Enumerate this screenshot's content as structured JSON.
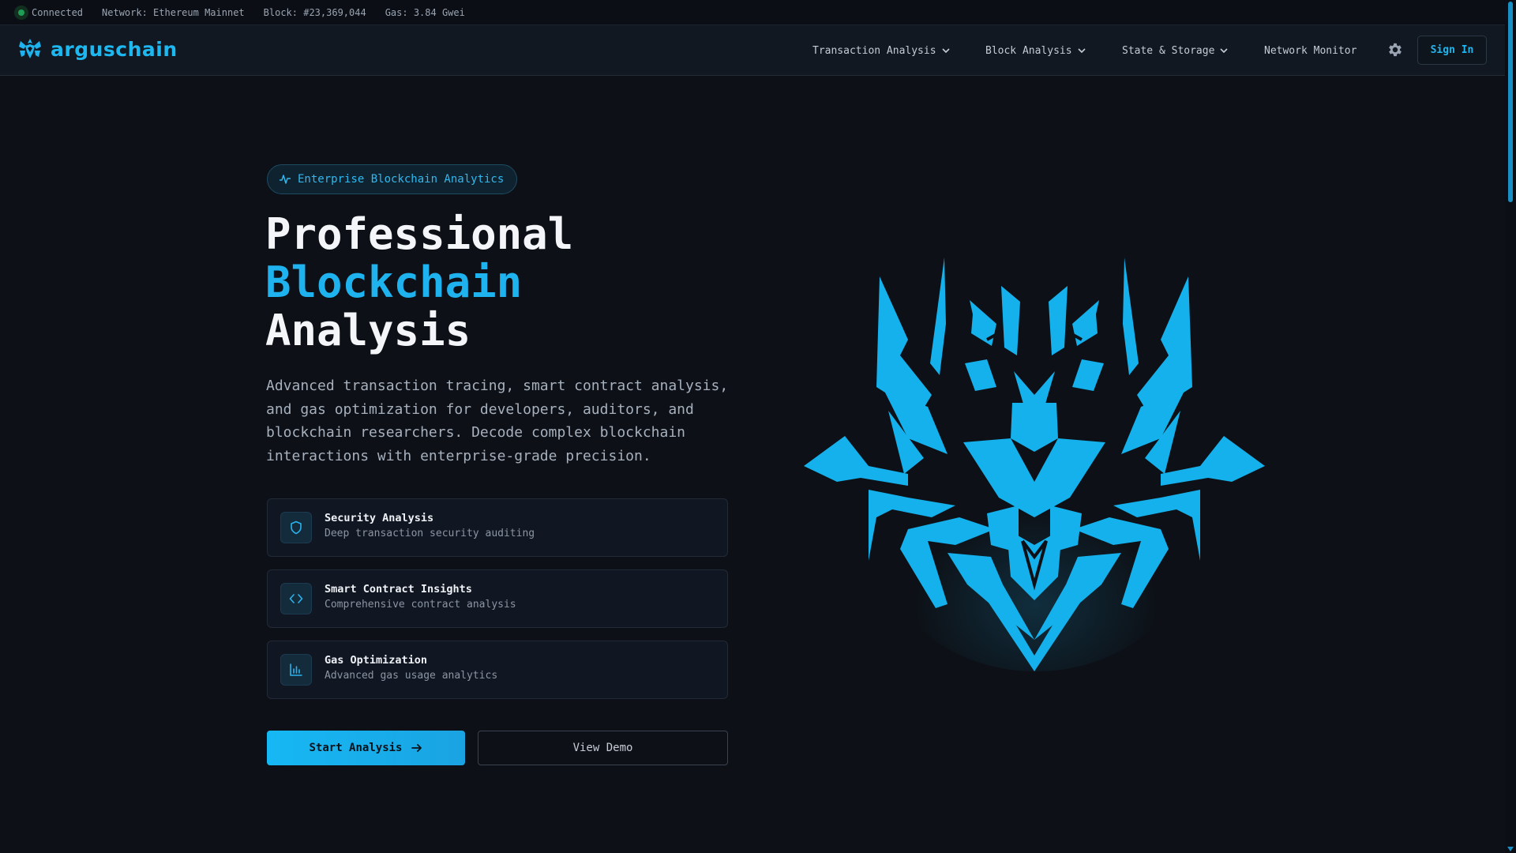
{
  "statusbar": {
    "connection": "Connected",
    "network": "Network: Ethereum Mainnet",
    "block": "Block: #23,369,044",
    "gas": "Gas: 3.84 Gwei"
  },
  "nav": {
    "brand": "arguschain",
    "items": [
      {
        "label": "Transaction Analysis",
        "icon": "chevron-down-icon"
      },
      {
        "label": "Block Analysis",
        "icon": "chevron-down-icon"
      },
      {
        "label": "State & Storage",
        "icon": "chevron-down-icon"
      },
      {
        "label": "Network Monitor"
      }
    ],
    "settings_icon": "gear-icon",
    "sign_in": "Sign In"
  },
  "hero": {
    "badge": "Enterprise Blockchain Analytics",
    "badge_icon": "activity-icon",
    "headline_line1": "Professional",
    "headline_line2": "Blockchain",
    "headline_line3": "Analysis",
    "description": "Advanced transaction tracing, smart contract analysis, and gas optimization for developers, auditors, and blockchain researchers. Decode complex blockchain interactions with enterprise-grade precision.",
    "features": [
      {
        "title": "Security Analysis",
        "desc": "Deep transaction security auditing",
        "icon": "shield-icon"
      },
      {
        "title": "Smart Contract Insights",
        "desc": "Comprehensive contract analysis",
        "icon": "code-icon"
      },
      {
        "title": "Gas Optimization",
        "desc": "Advanced gas usage analytics",
        "icon": "bar-chart-icon"
      }
    ],
    "primary_cta": "Start Analysis",
    "secondary_cta": "View Demo"
  },
  "colors": {
    "accent": "#1eb2ee",
    "background": "#0d1117",
    "status_ok": "#1f9d55"
  }
}
